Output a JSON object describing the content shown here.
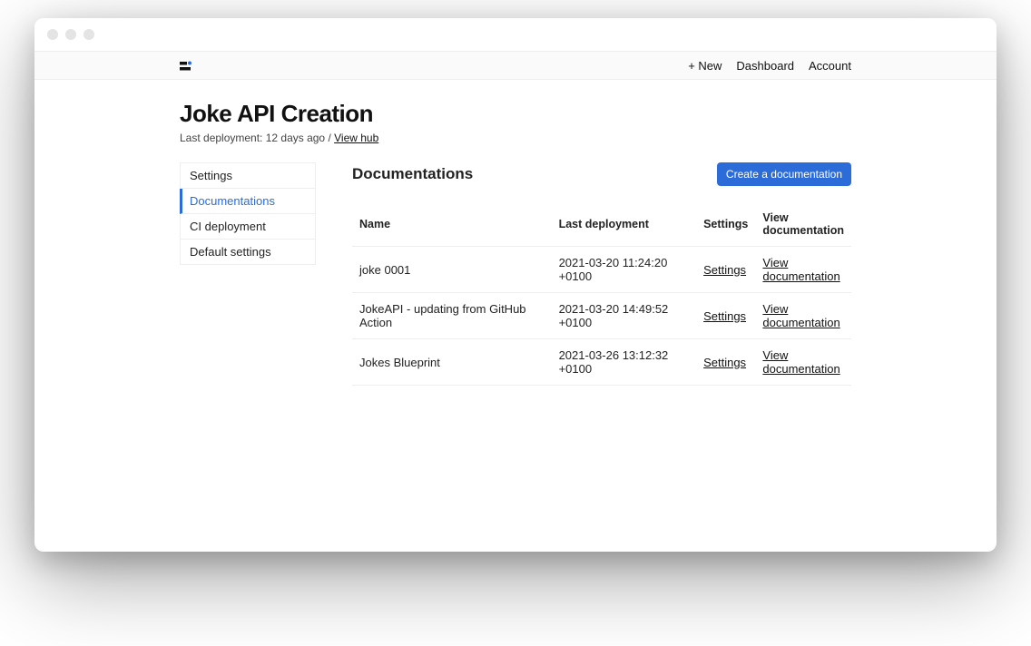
{
  "topnav": {
    "new": "+ New",
    "dashboard": "Dashboard",
    "account": "Account"
  },
  "header": {
    "title": "Joke API Creation",
    "subline_prefix": "Last deployment: 12 days ago / ",
    "view_hub": "View hub"
  },
  "sidebar": {
    "items": [
      {
        "label": "Settings",
        "active": false
      },
      {
        "label": "Documentations",
        "active": true
      },
      {
        "label": "CI deployment",
        "active": false
      },
      {
        "label": "Default settings",
        "active": false
      }
    ]
  },
  "section": {
    "title": "Documentations",
    "create_button": "Create a documentation"
  },
  "table": {
    "columns": {
      "name": "Name",
      "last_deployment": "Last deployment",
      "settings": "Settings",
      "view": "View documentation"
    },
    "settings_link": "Settings",
    "view_link": "View documentation",
    "rows": [
      {
        "name": "joke 0001",
        "last_deployment": "2021-03-20 11:24:20 +0100"
      },
      {
        "name": "JokeAPI - updating from GitHub Action",
        "last_deployment": "2021-03-20 14:49:52 +0100"
      },
      {
        "name": "Jokes Blueprint",
        "last_deployment": "2021-03-26 13:12:32 +0100"
      }
    ]
  }
}
